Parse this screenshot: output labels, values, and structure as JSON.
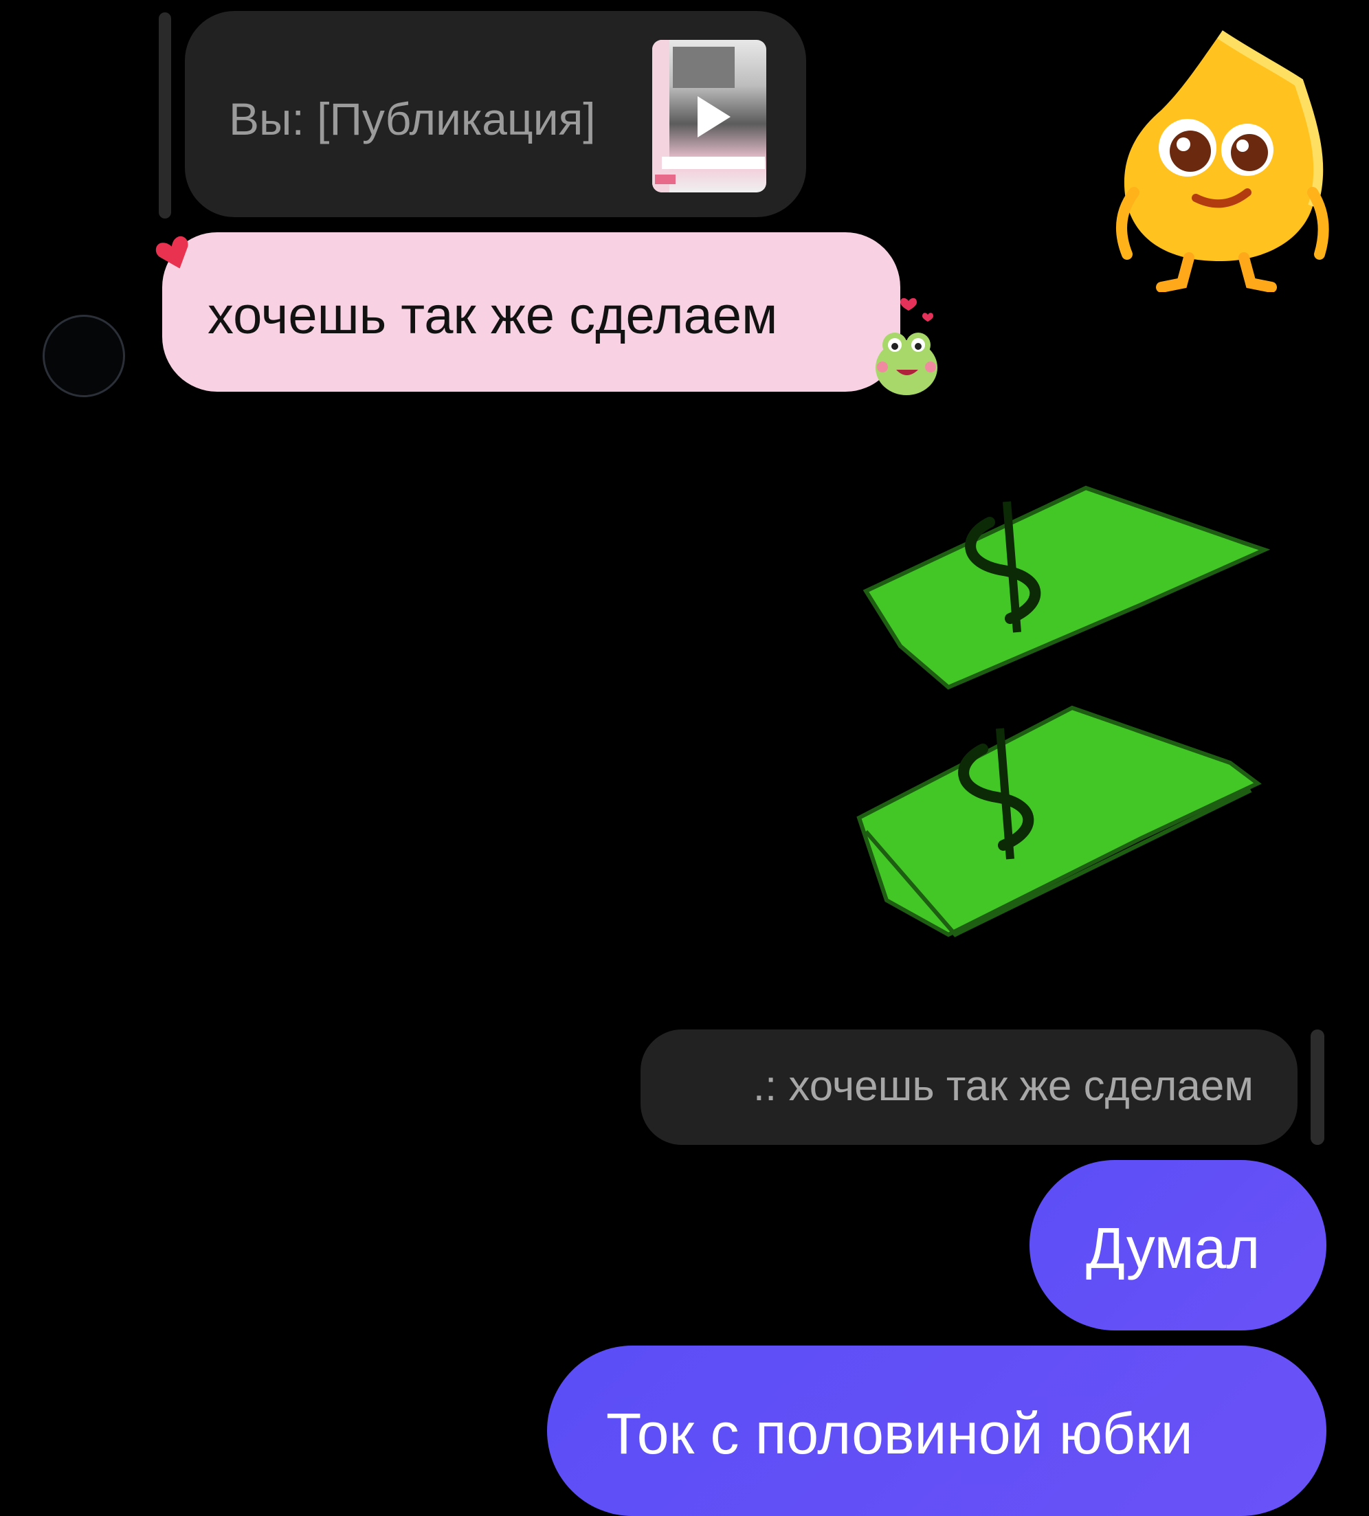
{
  "chat": {
    "incoming_reply_preview": "Вы: [Публикация]",
    "incoming_message": "хочешь так же сделаем",
    "outgoing_reply_preview": ".: хочешь так же сделаем",
    "outgoing_messages": [
      "Думал",
      "Ток с половиной юбки"
    ]
  },
  "icons": {
    "reaction": "heart-icon",
    "sticker_frog": "frog-sticker-icon",
    "sticker_mascot": "fire-mascot-icon",
    "sticker_money": "money-sticker-icon",
    "publication_play": "play-icon"
  },
  "colors": {
    "background": "#000000",
    "incoming_bubble": "#f8d2e2",
    "reply_bubble": "#222222",
    "outgoing_bubble": "#5b4ef6",
    "money_green": "#3fbf23"
  }
}
